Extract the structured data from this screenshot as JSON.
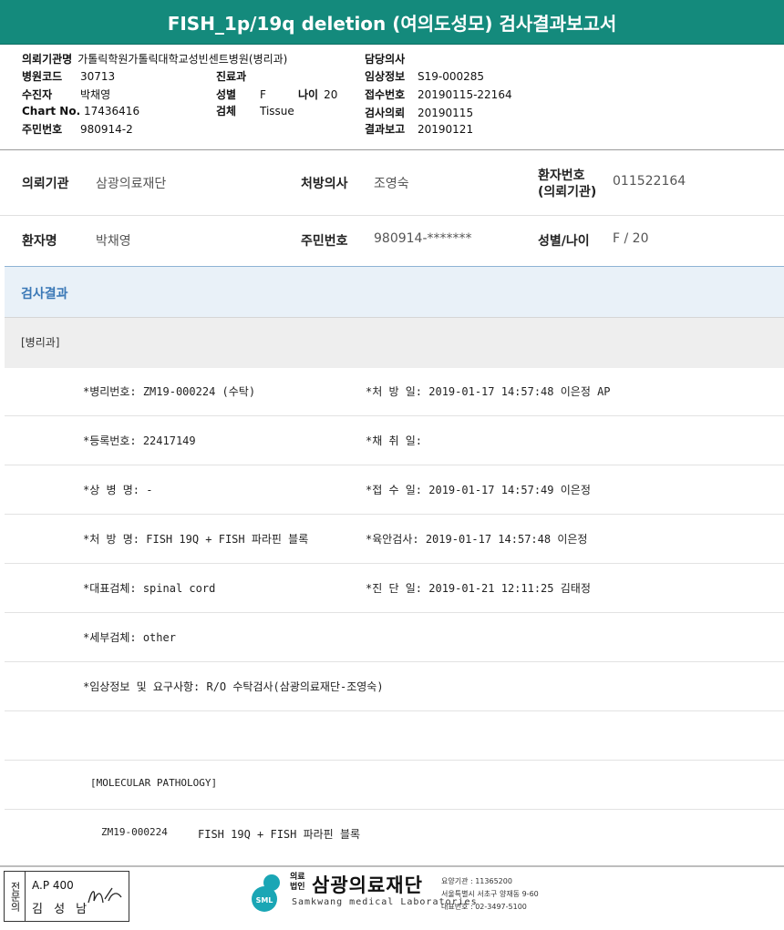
{
  "title": "FISH_1p/19q deletion (여의도성모) 검사결과보고서",
  "header": {
    "institution_label": "의뢰기관명",
    "institution_value": "가톨릭학원가톨릭대학교성빈센트병원(병리과)",
    "hospital_code_label": "병원코드",
    "hospital_code_value": "30713",
    "recipient_label": "수진자",
    "recipient_value": "박채영",
    "chart_label": "Chart No.",
    "chart_value": "17436416",
    "rrn_label": "주민번호",
    "rrn_value": "980914-2",
    "dept_label": "진료과",
    "dept_value": "",
    "sex_label": "성별",
    "sex_value": "F",
    "age_label": "나이",
    "age_value": "20",
    "specimen_label": "검체",
    "specimen_value": "Tissue",
    "doctor_label": "담당의사",
    "doctor_value": "",
    "clinical_label": "임상정보",
    "clinical_value": "S19-000285",
    "receipt_label": "접수번호",
    "receipt_value": "20190115-22164",
    "request_label": "검사의뢰",
    "request_value": "20190115",
    "report_label": "결과보고",
    "report_value": "20190121"
  },
  "info": {
    "inst_label": "의뢰기관",
    "inst_value": "삼광의료재단",
    "doctor_label": "처방의사",
    "doctor_value": "조영숙",
    "patno_label_1": "환자번호",
    "patno_label_2": "(의뢰기관)",
    "patno_value": "011522164",
    "name_label": "환자명",
    "name_value": "박채영",
    "rrn_label": "주민번호",
    "rrn_value": "980914-*******",
    "sexage_label": "성별/나이",
    "sexage_value": "F / 20"
  },
  "result": {
    "section_title": "검사결과",
    "dept": "[병리과]",
    "rows": [
      {
        "left": "*병리번호: ZM19-000224 (수탁)",
        "right": "*처 방 일: 2019-01-17 14:57:48  이은정 AP"
      },
      {
        "left": "*등록번호: 22417149",
        "right": "*채 취 일:"
      },
      {
        "left": "*상 병 명: -",
        "right": "*접 수 일: 2019-01-17 14:57:49  이은정"
      },
      {
        "left": "*처 방 명: FISH 19Q + FISH 파라핀 블록",
        "right": "*육안검사: 2019-01-17 14:57:48  이은정"
      },
      {
        "left": "*대표검체: spinal cord",
        "right": "*진 단 일: 2019-01-21 12:11:25  김태정"
      },
      {
        "left": "*세부검체: other",
        "right": ""
      },
      {
        "left": "*임상정보 및 요구사항: R/O 수탁검사(삼광의료재단-조영숙)",
        "right": ""
      }
    ],
    "mol_header": "[MOLECULAR PATHOLOGY]",
    "mol_line_id": "ZM19-000224",
    "mol_line_text": "FISH 19Q + FISH 파라핀 블록"
  },
  "footer": {
    "stamp_side": "전문의",
    "stamp_line1": "A.P 400",
    "stamp_line2": "김 성 남",
    "logo_text": "SML",
    "org_prefix": "의료법인",
    "org_name": "삼광의료재단",
    "org_en": "Samkwang medical Laboratories",
    "org_code": "요양기관 : 11365200",
    "org_addr": "서울특별시 서초구 양재동 9-60",
    "org_tel": "대표번호 : 02-3497-5100"
  },
  "colors": {
    "title_bg": "#148a7c",
    "section_title": "#3a78b6",
    "logo": "#1aa6b5"
  }
}
